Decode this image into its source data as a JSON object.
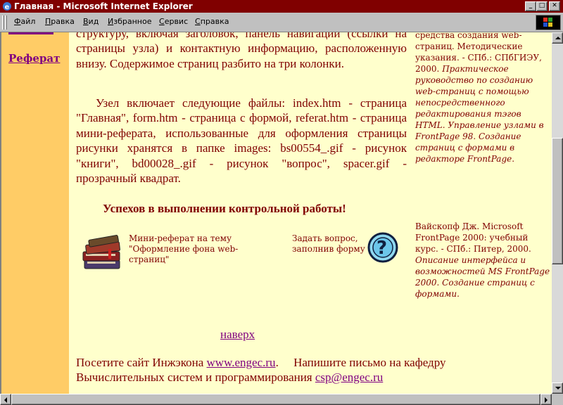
{
  "window": {
    "title": "Главная - Microsoft Internet Explorer",
    "min": "_",
    "max": "□",
    "close": "✕"
  },
  "menu": [
    {
      "label": "Файл"
    },
    {
      "label": "Правка"
    },
    {
      "label": "Вид"
    },
    {
      "label": "Избранное"
    },
    {
      "label": "Сервис"
    },
    {
      "label": "Справка"
    }
  ],
  "sidebar": {
    "link": "Реферат"
  },
  "main": {
    "p1": "структуру, включая заголовок, панель навигации (ссылки на страницы узла) и контактную информацию, расположенную внизу. Содержимое страниц разбито на три колонки.",
    "p2": "Узел включает следующие файлы: index.htm - страница \"Главная\", form.htm - страница с формой, referat.htm - страница мини-реферата, использованные для оформления страницы рисунки хранятся в папке images: bs00554_.gif - рисунок \"книги\", bd00028_.gif - рисунок \"вопрос\", spacer.gif - прозрачный квадрат.",
    "success": "Успехов в выполнении контрольной работы!",
    "referat_caption": "Мини-реферат на тему \"Оформление фона web-страниц\"",
    "question_caption": "Задать вопрос, заполнив форму",
    "top_link": "наверх"
  },
  "footer": {
    "line1_text": "Посетите сайт Инжэкона",
    "site_link": "www.engec.ru",
    "line1_rest": ".     Напишите письмо на кафедру",
    "line2_text": "Вычислительных систем и программирования",
    "email_link": "csp@engec.ru"
  },
  "right": {
    "b1_plain": "средства создания web-страниц. Методические указания. - СПб.: СПбГИЭУ, 2000.",
    "b1_italic": "Практическое руководство по созданию web-страниц с помощью непосредственного редактирования тэгов HTML. Управление узлами в FrontPage 98. Создание страниц с формами в редакторе FrontPage",
    "b1_end": ".",
    "b2_plain": "Вайскопф Дж. Microsoft FrontPage 2000: учебный курс. - СПб.: Питер, 2000.",
    "b2_italic": "Описание интерфейса и возможностей MS FrontPage 2000. Создание страниц с формами."
  },
  "colors": {
    "titlebar": "#800000",
    "content_bg": "#ffffcc",
    "sidebar_bg": "#ffcc66",
    "text": "#800000",
    "link": "#800080"
  },
  "icons": [
    "ie-icon",
    "books-icon",
    "question-icon",
    "windows-logo-icon"
  ]
}
